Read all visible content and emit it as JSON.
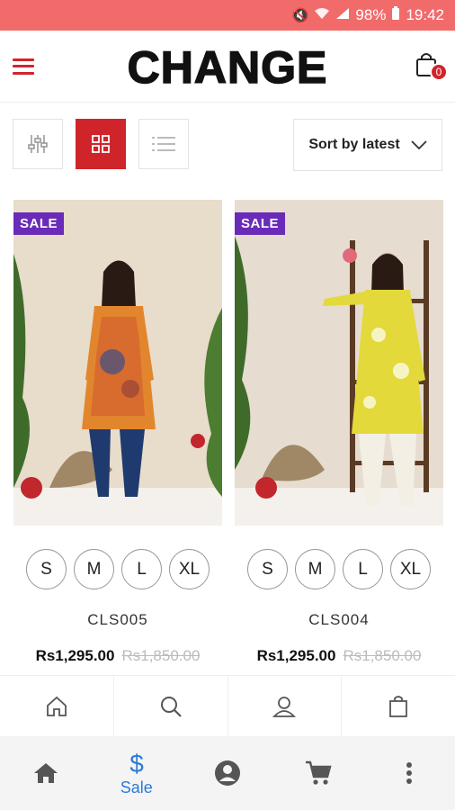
{
  "status_bar": {
    "battery": "98%",
    "time": "19:42"
  },
  "header": {
    "brand": "CHANGE",
    "cart_count": "0"
  },
  "toolbar": {
    "sort_label": "Sort by latest"
  },
  "products": [
    {
      "badge": "SALE",
      "title": "CLS005",
      "price": "Rs1,295.00",
      "old_price": "Rs1,850.00",
      "sizes": [
        "S",
        "M",
        "L",
        "XL"
      ]
    },
    {
      "badge": "SALE",
      "title": "CLS004",
      "price": "Rs1,295.00",
      "old_price": "Rs1,850.00",
      "sizes": [
        "S",
        "M",
        "L",
        "XL"
      ]
    }
  ],
  "bottom_nav": {
    "active_label": "Sale"
  },
  "colors": {
    "accent": "#d0242b",
    "badge": "#6a2bb8",
    "nav_active": "#2a7bd6"
  }
}
